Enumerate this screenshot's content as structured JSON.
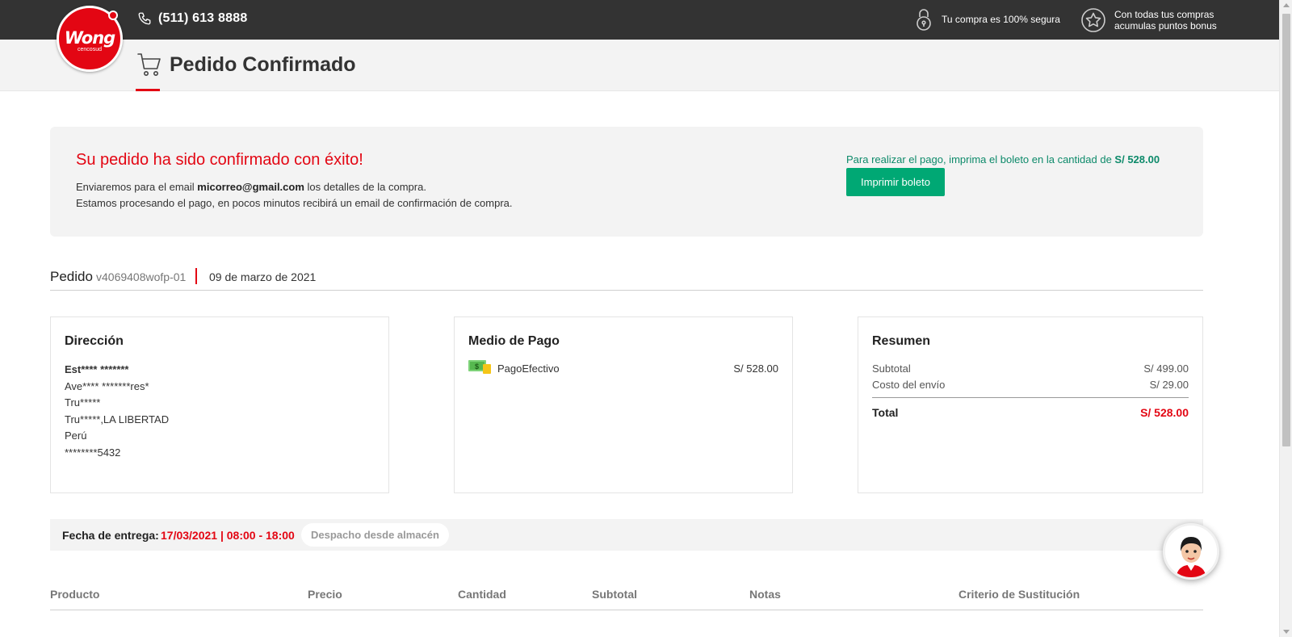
{
  "header": {
    "phone": "(511) 613 8888",
    "logo_word": "Wong",
    "logo_sub": "cencosud",
    "secure_text": "Tu compra es 100% segura",
    "bonus_line1": "Con todas tus compras",
    "bonus_line2": "acumulas puntos bonus"
  },
  "page": {
    "title": "Pedido Confirmado"
  },
  "banner": {
    "title": "Su pedido ha sido confirmado con éxito!",
    "email_prefix": "Enviaremos para el email ",
    "email": "micorreo@gmail.com",
    "email_suffix": " los detalles de la compra.",
    "processing": "Estamos procesando el pago, en pocos minutos recibirá un email de confirmación de compra.",
    "pay_note": "Para realizar el pago, imprima el boleto en la cantidad de ",
    "pay_amount": "S/ 528.00",
    "print_button": "Imprimir boleto"
  },
  "order": {
    "label": "Pedido",
    "id": "v4069408wofp-01",
    "date": "09 de marzo de 2021"
  },
  "address": {
    "title": "Dirección",
    "lines": [
      "Est**** *******",
      "Ave**** *******res*",
      "Tru*****",
      "Tru*****,LA LIBERTAD",
      "Perú",
      "********5432"
    ]
  },
  "payment": {
    "title": "Medio de Pago",
    "method": "PagoEfectivo",
    "amount": "S/ 528.00",
    "icon": "cash-icon"
  },
  "summary": {
    "title": "Resumen",
    "subtotal_label": "Subtotal",
    "subtotal_value": "S/ 499.00",
    "shipping_label": "Costo del envío",
    "shipping_value": "S/ 29.00",
    "total_label": "Total",
    "total_value": "S/ 528.00"
  },
  "delivery": {
    "label": "Fecha de entrega: ",
    "value": "17/03/2021 | 08:00 - 18:00",
    "chip": "Despacho desde almacén"
  },
  "table": {
    "headers": [
      "Producto",
      "Precio",
      "Cantidad",
      "Subtotal",
      "Notas",
      "Criterio de Sustitución"
    ]
  },
  "colors": {
    "brand_red": "#e30613",
    "topbar": "#333333",
    "button_green": "#00a874",
    "note_green": "#0d8a6a"
  }
}
